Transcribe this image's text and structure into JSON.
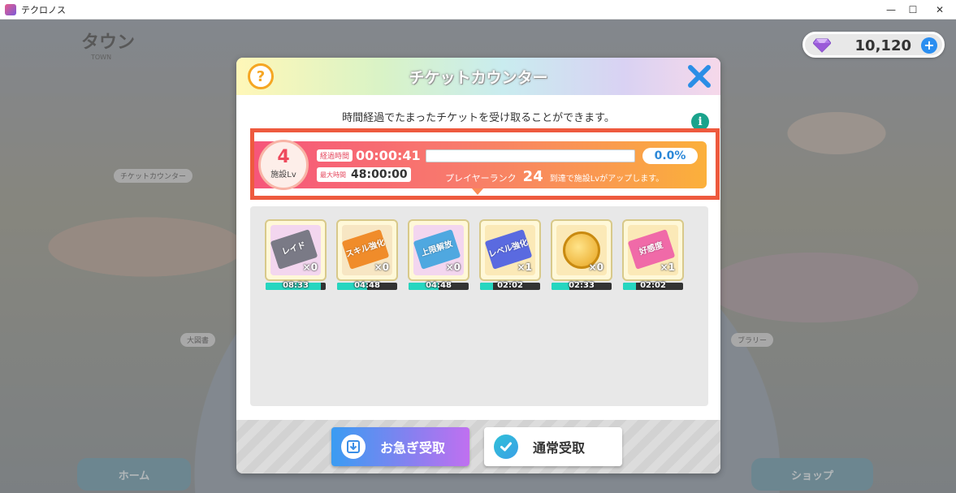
{
  "window": {
    "title": "テクロノス",
    "minimize_glyph": "—",
    "maximize_glyph": "☐",
    "close_glyph": "✕"
  },
  "background": {
    "town_title": "タウン",
    "town_subtitle": "TOWN",
    "tag_ticket_counter": "チケットカウンター",
    "tag_other_left": "大図書",
    "tag_other_right": "ブラリー",
    "nav": {
      "home": "ホーム",
      "shop": "ショップ"
    }
  },
  "currency": {
    "icon": "diamond-icon",
    "value": "10,120",
    "plus": "+"
  },
  "dialog": {
    "help": "?",
    "title": "チケットカウンター",
    "description": "時間経過でたまったチケットを受け取ることができます。",
    "info": "i",
    "facility": {
      "level": "4",
      "level_label": "施設Lv",
      "elapsed_label": "経過時間",
      "elapsed_value": "00:00:41",
      "max_label": "最大時間",
      "max_value": "48:00:00",
      "progress_percent": "0.0%",
      "progress_fraction": 0.0,
      "rank_label": "プレイヤーランク",
      "rank_value": "24",
      "rank_suffix": "到達で施設Lvがアップします。"
    },
    "tickets": [
      {
        "label": "レイド",
        "count": "×0",
        "timer": "08:33",
        "fill": 0.92,
        "bg": "#f3d6ef",
        "color": "#7a7a86"
      },
      {
        "label": "スキル強化",
        "count": "×0",
        "timer": "04:48",
        "fill": 0.5,
        "bg": "#f7e6c3",
        "color": "#f08c2a"
      },
      {
        "label": "上限解放",
        "count": "×0",
        "timer": "04:48",
        "fill": 0.5,
        "bg": "#f3d6ef",
        "color": "#4fa8e0"
      },
      {
        "label": "レベル強化",
        "count": "×1",
        "timer": "02:02",
        "fill": 0.22,
        "bg": "#fbe9b7",
        "color": "#5a6ae0"
      },
      {
        "label": "",
        "count": "×0",
        "timer": "02:33",
        "fill": 0.3,
        "bg": "#fbe9b7",
        "color": "#e8a420"
      },
      {
        "label": "好感度",
        "count": "×1",
        "timer": "02:02",
        "fill": 0.22,
        "bg": "#fbe9b7",
        "color": "#f06aa8"
      }
    ],
    "buttons": {
      "quick": "お急ぎ受取",
      "normal": "通常受取"
    }
  },
  "colors": {
    "highlight_border": "#ee5a3e",
    "accent_blue": "#2b8ef0"
  }
}
